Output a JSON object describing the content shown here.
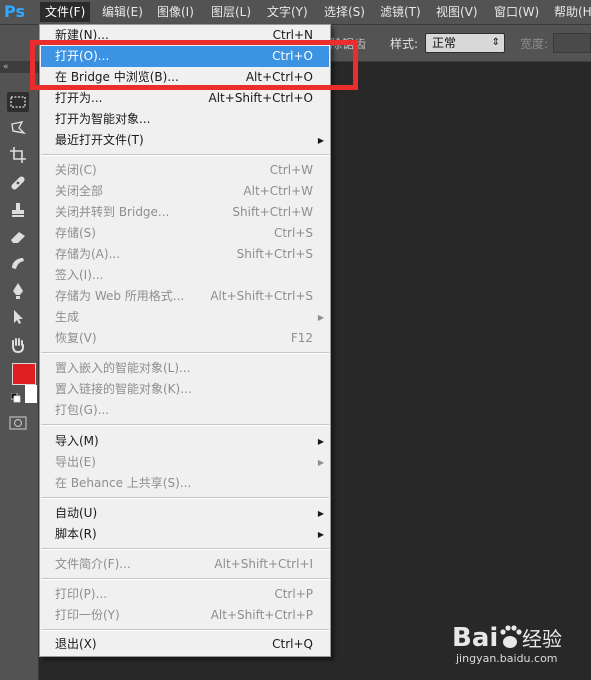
{
  "app": {
    "logo": "Ps"
  },
  "menubar": {
    "items": [
      {
        "label": "文件(F)"
      },
      {
        "label": "编辑(E)"
      },
      {
        "label": "图像(I)"
      },
      {
        "label": "图层(L)"
      },
      {
        "label": "文字(Y)"
      },
      {
        "label": "选择(S)"
      },
      {
        "label": "滤镜(T)"
      },
      {
        "label": "视图(V)"
      },
      {
        "label": "窗口(W)"
      },
      {
        "label": "帮助(H"
      }
    ],
    "active_index": 0
  },
  "options_bar": {
    "partial_text": "除锯齿",
    "style_label": "样式:",
    "style_value": "正常",
    "width_label": "宽度:"
  },
  "toolbar": {
    "collapse_glyph": "«",
    "tools": [
      {
        "icon": "rectangular-marquee-icon"
      },
      {
        "icon": "lasso-icon"
      },
      {
        "icon": "crop-icon"
      },
      {
        "icon": "healing-brush-icon"
      },
      {
        "icon": "clone-stamp-icon"
      },
      {
        "icon": "eraser-icon"
      },
      {
        "icon": "smudge-icon"
      },
      {
        "icon": "pen-icon"
      },
      {
        "icon": "path-selection-icon"
      },
      {
        "icon": "hand-icon"
      }
    ],
    "foreground_color": "#e02020",
    "background_color": "#ffffff"
  },
  "file_menu": {
    "items": [
      {
        "label": "新建(N)...",
        "shortcut": "Ctrl+N",
        "state": "normal"
      },
      {
        "label": "打开(O)...",
        "shortcut": "Ctrl+O",
        "state": "highlighted"
      },
      {
        "label": "在 Bridge 中浏览(B)...",
        "shortcut": "Alt+Ctrl+O",
        "state": "normal"
      },
      {
        "label": "打开为...",
        "shortcut": "Alt+Shift+Ctrl+O",
        "state": "normal"
      },
      {
        "label": "打开为智能对象...",
        "shortcut": "",
        "state": "normal"
      },
      {
        "label": "最近打开文件(T)",
        "shortcut": "",
        "state": "submenu"
      },
      {
        "label": "关闭(C)",
        "shortcut": "Ctrl+W",
        "state": "disabled"
      },
      {
        "label": "关闭全部",
        "shortcut": "Alt+Ctrl+W",
        "state": "disabled"
      },
      {
        "label": "关闭并转到 Bridge...",
        "shortcut": "Shift+Ctrl+W",
        "state": "disabled"
      },
      {
        "label": "存储(S)",
        "shortcut": "Ctrl+S",
        "state": "disabled"
      },
      {
        "label": "存储为(A)...",
        "shortcut": "Shift+Ctrl+S",
        "state": "disabled"
      },
      {
        "label": "签入(I)...",
        "shortcut": "",
        "state": "disabled"
      },
      {
        "label": "存储为 Web 所用格式...",
        "shortcut": "Alt+Shift+Ctrl+S",
        "state": "disabled"
      },
      {
        "label": "生成",
        "shortcut": "",
        "state": "disabled-submenu"
      },
      {
        "label": "恢复(V)",
        "shortcut": "F12",
        "state": "disabled"
      },
      {
        "label": "置入嵌入的智能对象(L)...",
        "shortcut": "",
        "state": "disabled"
      },
      {
        "label": "置入链接的智能对象(K)...",
        "shortcut": "",
        "state": "disabled"
      },
      {
        "label": "打包(G)...",
        "shortcut": "",
        "state": "disabled"
      },
      {
        "label": "导入(M)",
        "shortcut": "",
        "state": "submenu"
      },
      {
        "label": "导出(E)",
        "shortcut": "",
        "state": "disabled-submenu"
      },
      {
        "label": "在 Behance 上共享(S)...",
        "shortcut": "",
        "state": "disabled"
      },
      {
        "label": "自动(U)",
        "shortcut": "",
        "state": "submenu"
      },
      {
        "label": "脚本(R)",
        "shortcut": "",
        "state": "submenu"
      },
      {
        "label": "文件简介(F)...",
        "shortcut": "Alt+Shift+Ctrl+I",
        "state": "disabled"
      },
      {
        "label": "打印(P)...",
        "shortcut": "Ctrl+P",
        "state": "disabled"
      },
      {
        "label": "打印一份(Y)",
        "shortcut": "Alt+Shift+Ctrl+P",
        "state": "disabled"
      },
      {
        "label": "退出(X)",
        "shortcut": "Ctrl+Q",
        "state": "normal"
      }
    ]
  },
  "annotation": {
    "highlight_color": "#ec2d2d"
  },
  "watermark": {
    "logo_text": "Bai 经验",
    "url": "jingyan.baidu.com"
  },
  "colors": {
    "accent": "#3c93e4",
    "panel": "#535353",
    "canvas": "#282828"
  }
}
